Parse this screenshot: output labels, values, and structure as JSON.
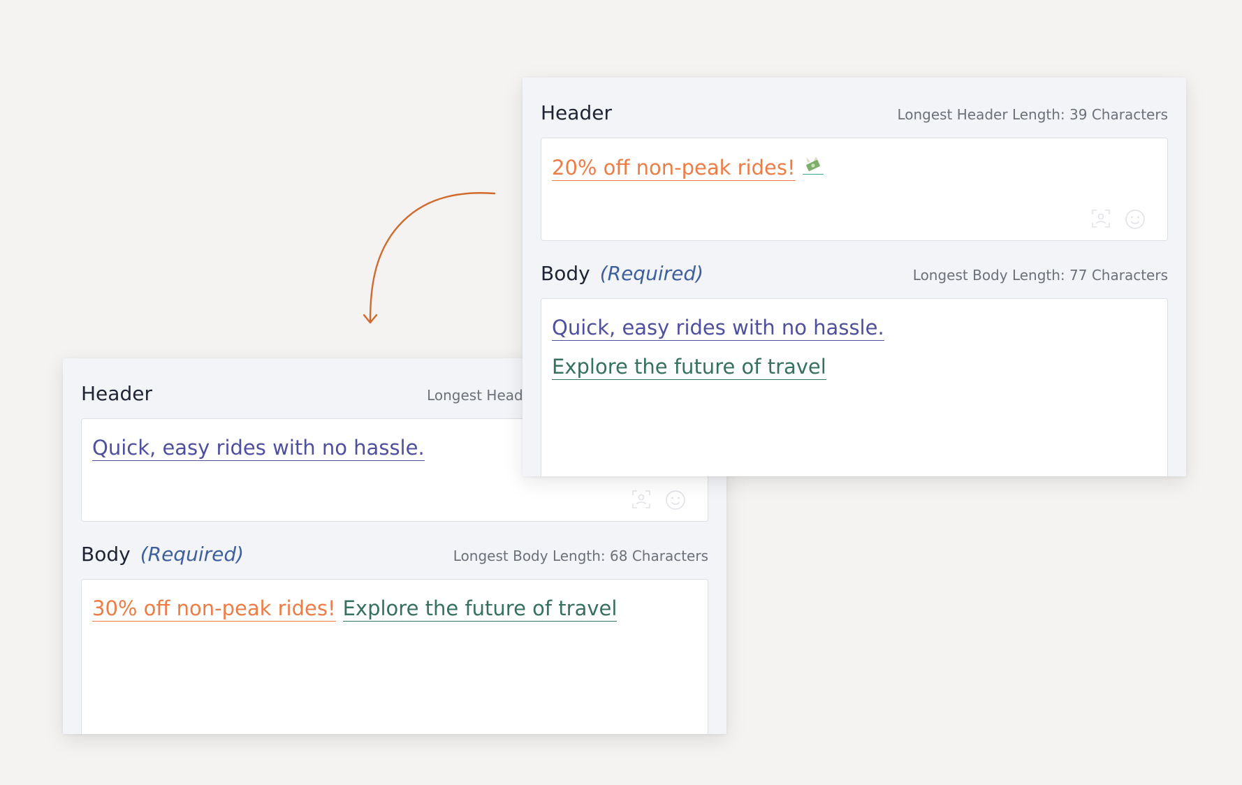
{
  "colors": {
    "accent_orange": "#ee7d45",
    "variant_blue": "#4e4f9e",
    "variant_green": "#367060",
    "required_blue": "#3d5f9e",
    "arrow": "#d16a2c"
  },
  "front_panel": {
    "header_label": "Header",
    "header_hint": "Longest Header Length: 39 Characters",
    "header_segments": [
      "20% off non-peak rides!"
    ],
    "header_emoji_icon": "money-with-wings-icon",
    "body_label": "Body",
    "body_required": "(Required)",
    "body_hint": "Longest Body Length: 77 Characters",
    "body_lines": [
      "Quick, easy rides with no hassle.",
      "Explore the future of travel"
    ]
  },
  "back_panel": {
    "header_label": "Header",
    "header_hint": "Longest Heade",
    "header_segments": [
      "Quick, easy rides with no hassle."
    ],
    "body_label": "Body",
    "body_required": "(Required)",
    "body_hint": "Longest Body Length: 68 Characters",
    "body_segments": [
      "30% off non-peak rides!",
      "Explore the future of travel"
    ]
  }
}
